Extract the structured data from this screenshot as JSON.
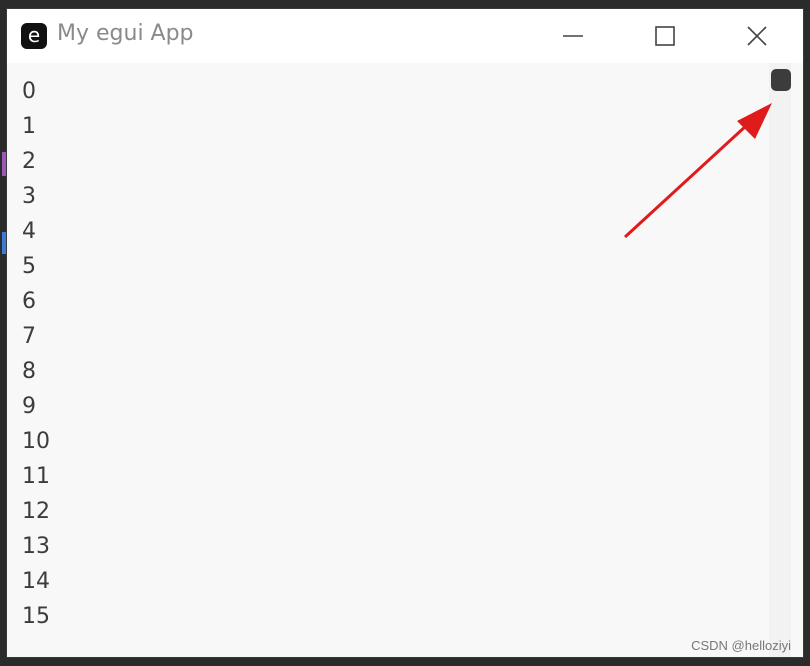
{
  "window": {
    "title": "My egui App",
    "icon_letter": "e"
  },
  "list": {
    "items": [
      "0",
      "1",
      "2",
      "3",
      "4",
      "5",
      "6",
      "7",
      "8",
      "9",
      "10",
      "11",
      "12",
      "13",
      "14",
      "15"
    ]
  },
  "annotation": {
    "arrow_color": "#e01b1b"
  },
  "watermark": "CSDN @helloziyi",
  "colors": {
    "window_bg": "#f8f8f8",
    "titlebar_bg": "#ffffff",
    "text": "#3c3c3c",
    "scroll_thumb": "#3c3c3c"
  }
}
